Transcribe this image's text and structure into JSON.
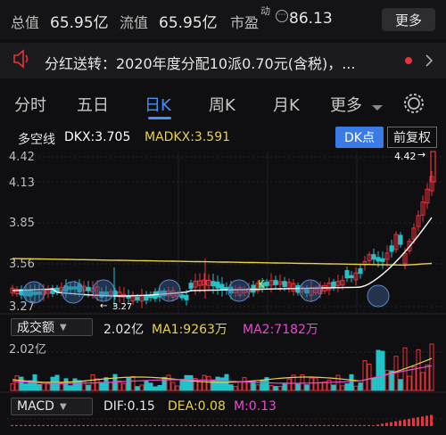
{
  "header": {
    "total_label": "总值",
    "total_value": "65.95亿",
    "float_label": "流值",
    "float_value": "65.95亿",
    "pe_label": "市盈",
    "pe_sup": "动",
    "pe_value": "86.13",
    "more_label": "更多"
  },
  "notice": {
    "text": "分红送转：2020年度分配10派0.70元(含税)，..."
  },
  "tabs": [
    {
      "label": "分时"
    },
    {
      "label": "五日"
    },
    {
      "label": "日K"
    },
    {
      "label": "周K"
    },
    {
      "label": "月K"
    },
    {
      "label": "更多"
    }
  ],
  "indicator": {
    "name": "多空线",
    "dkx": "DKX:3.705",
    "madkx": "MADKX:3.591",
    "dk_button": "DK点",
    "fq_button": "前复权"
  },
  "price_axis": [
    "4.42",
    "4.13",
    "3.85",
    "3.56",
    "3.27"
  ],
  "annotations": {
    "high_marker": "4.42",
    "low_marker": "3.27",
    "k_marker": "K"
  },
  "volume": {
    "button": "成交额",
    "value": "2.02亿",
    "ma1": "MA1:9263万",
    "ma2": "MA2:7182万",
    "axis_top": "2.02亿"
  },
  "macd": {
    "button": "MACD",
    "dif": "DIF:0.15",
    "dea": "DEA:0.08",
    "m": "M:0.13"
  },
  "colors": {
    "up": "#e8323c",
    "down": "#21c2c8",
    "accent": "#4a8ff5",
    "dkx": "#ffffff",
    "madkx": "#e8d24a",
    "ma1": "#e8d24a",
    "ma2": "#e84ad1"
  }
}
